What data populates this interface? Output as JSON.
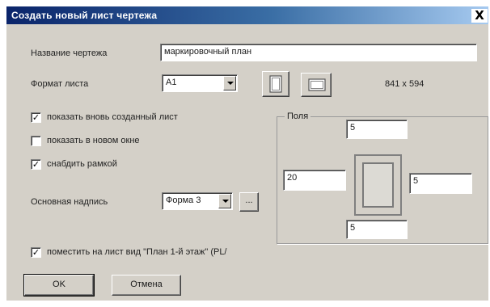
{
  "window": {
    "title": "Создать новый лист чертежа",
    "close_glyph": "X"
  },
  "form": {
    "drawing_name_label": "Название чертежа",
    "drawing_name_value": "маркировочный план",
    "sheet_format_label": "Формат листа",
    "sheet_format_value": "A1",
    "sheet_size": "841 x 594",
    "show_new_sheet_label": "показать вновь созданный лист",
    "show_new_sheet_checked": true,
    "show_new_window_label": "показать в новом окне",
    "show_new_window_checked": false,
    "frame_label": "снабдить рамкой",
    "frame_checked": true,
    "title_block_label": "Основная надпись",
    "title_block_value": "Форма 3",
    "browse_label": "...",
    "place_view_label": "поместить на лист вид \"План 1-й этаж\" (PL/",
    "place_view_checked": true
  },
  "margins": {
    "group_label": "Поля",
    "top": "5",
    "left": "20",
    "right": "5",
    "bottom": "5"
  },
  "buttons": {
    "ok": "OK",
    "cancel": "Отмена"
  },
  "icons": {
    "portrait": "portrait-orientation-icon",
    "landscape": "landscape-orientation-icon",
    "checkmark": "✓"
  }
}
